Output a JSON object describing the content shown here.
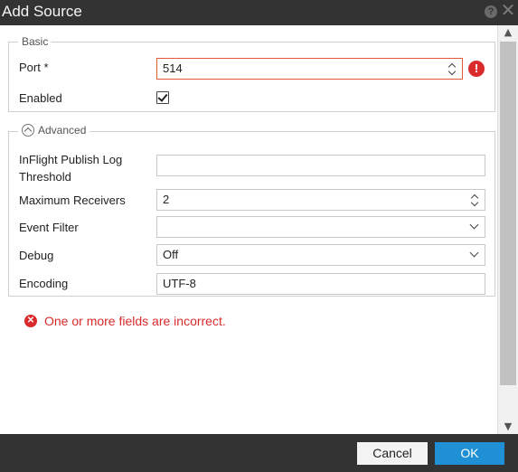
{
  "dialog": {
    "title": "Add Source",
    "help_icon": "help-icon",
    "close_icon": "close-icon"
  },
  "basic": {
    "legend": "Basic",
    "port_label": "Port *",
    "port_value": "514",
    "enabled_label": "Enabled",
    "enabled_checked": true
  },
  "advanced": {
    "legend": "Advanced",
    "inflight_label": "InFlight Publish Log Threshold",
    "inflight_value": "",
    "max_receivers_label": "Maximum Receivers",
    "max_receivers_value": "2",
    "event_filter_label": "Event Filter",
    "event_filter_value": "",
    "debug_label": "Debug",
    "debug_value": "Off",
    "encoding_label": "Encoding",
    "encoding_value": "UTF-8"
  },
  "validation": {
    "message": "One or more fields are incorrect.",
    "error_color": "#d92b2b"
  },
  "footer": {
    "cancel_label": "Cancel",
    "ok_label": "OK",
    "ok_color": "#1f8fd6"
  }
}
